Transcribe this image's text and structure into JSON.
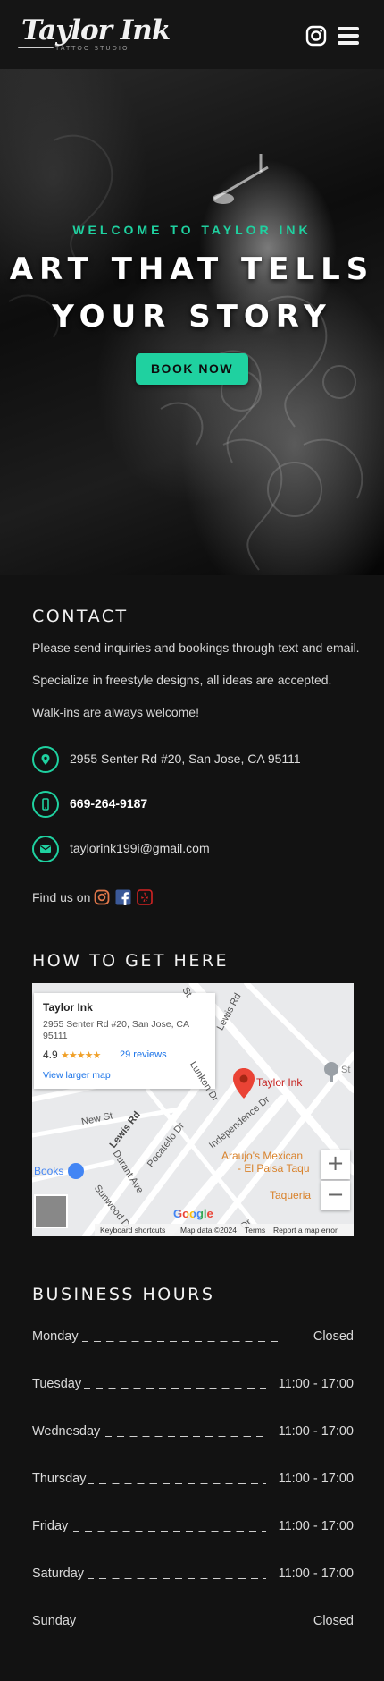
{
  "header": {
    "logo_text": "Taylor Ink",
    "logo_subtext": "TATTOO STUDIO",
    "instagram_icon": "instagram-icon",
    "menu_icon": "hamburger-menu-icon"
  },
  "hero": {
    "eyebrow": "WELCOME TO TAYLOR INK",
    "title_line1": "ART THAT TELLS",
    "title_line2": "YOUR STORY",
    "cta_label": "BOOK NOW"
  },
  "contact": {
    "title": "CONTACT",
    "paragraphs": [
      "Please send inquiries and bookings through text and email.",
      "Specialize in freestyle designs, all ideas are accepted.",
      "Walk-ins are always welcome!"
    ],
    "address": "2955 Senter Rd #20, San Jose, CA 95111",
    "phone": "669-264-9187",
    "email": "taylorink199i@gmail.com",
    "find_us_label": "Find us on",
    "socials": [
      "instagram-icon",
      "facebook-icon",
      "yelp-icon"
    ]
  },
  "directions": {
    "title": "HOW TO GET HERE",
    "map": {
      "place_name": "Taylor Ink",
      "place_address": "2955 Senter Rd #20, San Jose, CA 95111",
      "rating": "4.9",
      "stars": "★★★★★",
      "reviews": "29 reviews",
      "larger_map": "View larger map",
      "pin_label": "Taylor Ink",
      "streets": [
        "Lewis Rd",
        "New St",
        "Lewis Rd",
        "Pocatello Dr",
        "Independence Dr",
        "Durant Ave",
        "Sunwood Dr",
        "Dr",
        "Lunken Dr",
        "St"
      ],
      "places": [
        "Araujo's Mexican",
        "- El Paisa Taqu",
        "Taqueria",
        "Books",
        "St"
      ],
      "zoom_in": "+",
      "zoom_out": "−",
      "google": "Google",
      "footer": [
        "Keyboard shortcuts",
        "Map data ©2024",
        "Terms",
        "Report a map error"
      ]
    }
  },
  "hours": {
    "title": "BUSINESS HOURS",
    "rows": [
      {
        "day": "Monday",
        "time": "Closed"
      },
      {
        "day": "Tuesday",
        "time": "11:00 - 17:00"
      },
      {
        "day": "Wednesday",
        "time": "11:00 - 17:00"
      },
      {
        "day": "Thursday",
        "time": "11:00 - 17:00"
      },
      {
        "day": "Friday",
        "time": "11:00 - 17:00"
      },
      {
        "day": "Saturday",
        "time": "11:00 - 17:00"
      },
      {
        "day": "Sunday",
        "time": "Closed"
      }
    ]
  },
  "colors": {
    "accent": "#1fd1a0",
    "background": "#121212",
    "header": "#151515"
  }
}
